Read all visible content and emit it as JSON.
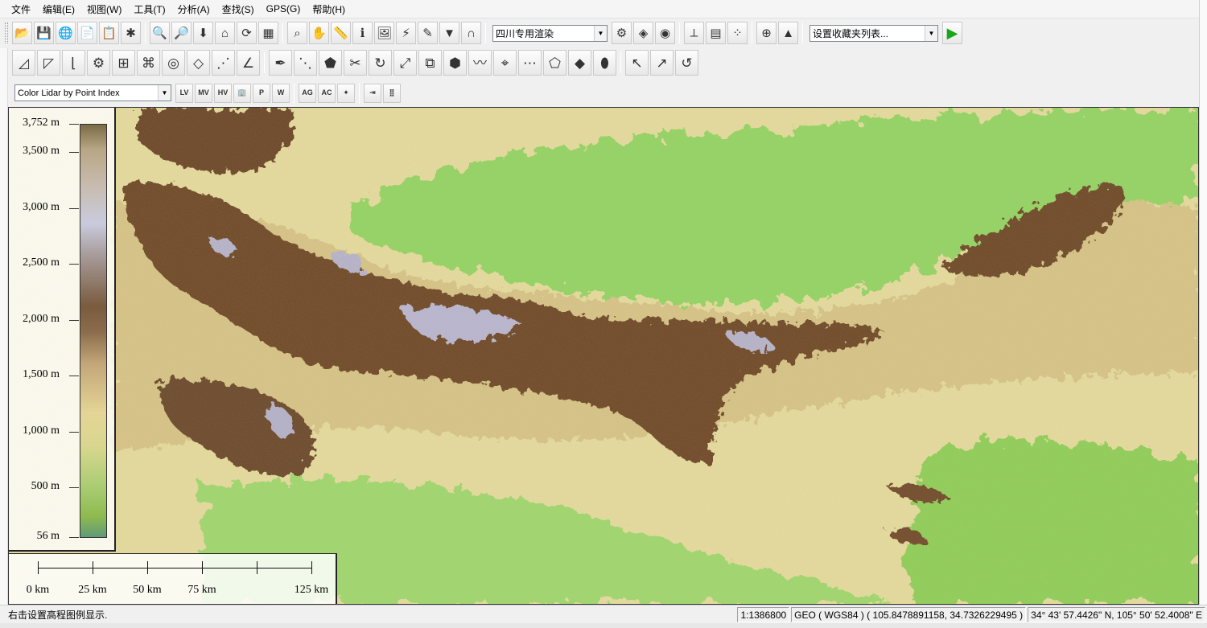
{
  "menu": [
    "文件",
    "编辑(E)",
    "视图(W)",
    "工具(T)",
    "分析(A)",
    "查找(S)",
    "GPS(G)",
    "帮助(H)"
  ],
  "toolbar1": {
    "render_combo": "四川专用渲染",
    "favorites_combo": "设置收藏夹列表..."
  },
  "toolbar3": {
    "color_combo": "Color Lidar by Point Index",
    "button_labels": [
      "LV",
      "MV",
      "HV",
      "",
      "P",
      "W",
      "AG",
      "AC",
      "",
      "",
      ""
    ]
  },
  "legend": {
    "labels": [
      "3,752 m",
      "3,500 m",
      "3,000 m",
      "2,500 m",
      "2,000 m",
      "1,500 m",
      "1,000 m",
      "500 m",
      "56 m"
    ]
  },
  "scalebar": {
    "labels": [
      "0 km",
      "25 km",
      "50 km",
      "75 km",
      "125 km"
    ]
  },
  "status": {
    "hint": "右击设置高程图例显示.",
    "scale": "1:1386800",
    "coords": "GEO ( WGS84 ) ( 105.8478891158, 34.7326229495 )",
    "dms": "34° 43' 57.4426\" N, 105° 50' 52.4008\" E"
  },
  "colors": {
    "lowland": "#86d35c",
    "plain": "#e8dc9c",
    "mountain": "#6e4a2c",
    "peak": "#b9b9d6"
  }
}
